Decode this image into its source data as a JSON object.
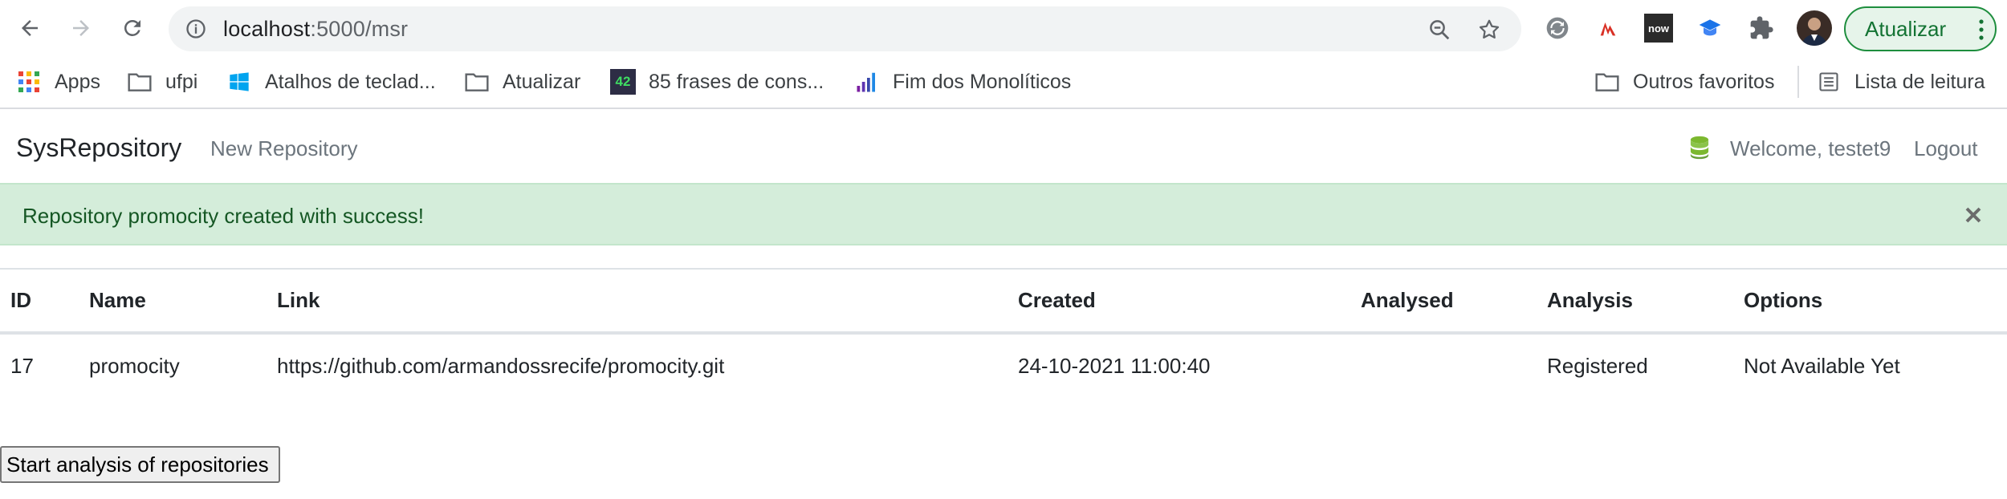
{
  "browser": {
    "url_host": "localhost",
    "url_path": ":5000/msr",
    "update_label": "Atualizar",
    "ext_badge": "now"
  },
  "bookmarks": {
    "items": [
      {
        "label": "Apps",
        "icon": "apps-grid-icon"
      },
      {
        "label": "ufpi",
        "icon": "folder-icon"
      },
      {
        "label": "Atalhos de teclad...",
        "icon": "windows-icon"
      },
      {
        "label": "Atualizar",
        "icon": "folder-icon"
      },
      {
        "label": "85 frases de cons...",
        "icon": "42-icon",
        "badge": "42"
      },
      {
        "label": "Fim dos Monolíticos",
        "icon": "bar-chart-icon"
      }
    ],
    "other_favorites": "Outros favoritos",
    "reading_list": "Lista de leitura"
  },
  "navbar": {
    "brand": "SysRepository",
    "new_repo": "New Repository",
    "welcome": "Welcome, testet9",
    "logout": "Logout"
  },
  "alert": {
    "message": "Repository promocity created with success!",
    "close": "×",
    "color": "#d4edda"
  },
  "table": {
    "headers": [
      "ID",
      "Name",
      "Link",
      "Created",
      "Analysed",
      "Analysis",
      "Options"
    ],
    "rows": [
      {
        "id": "17",
        "name": "promocity",
        "link": "https://github.com/armandossrecife/promocity.git",
        "created": "24-10-2021 11:00:40",
        "analysed": "",
        "analysis": "Registered",
        "options": "Not Available Yet"
      }
    ]
  },
  "start_button": "Start analysis of repositories"
}
